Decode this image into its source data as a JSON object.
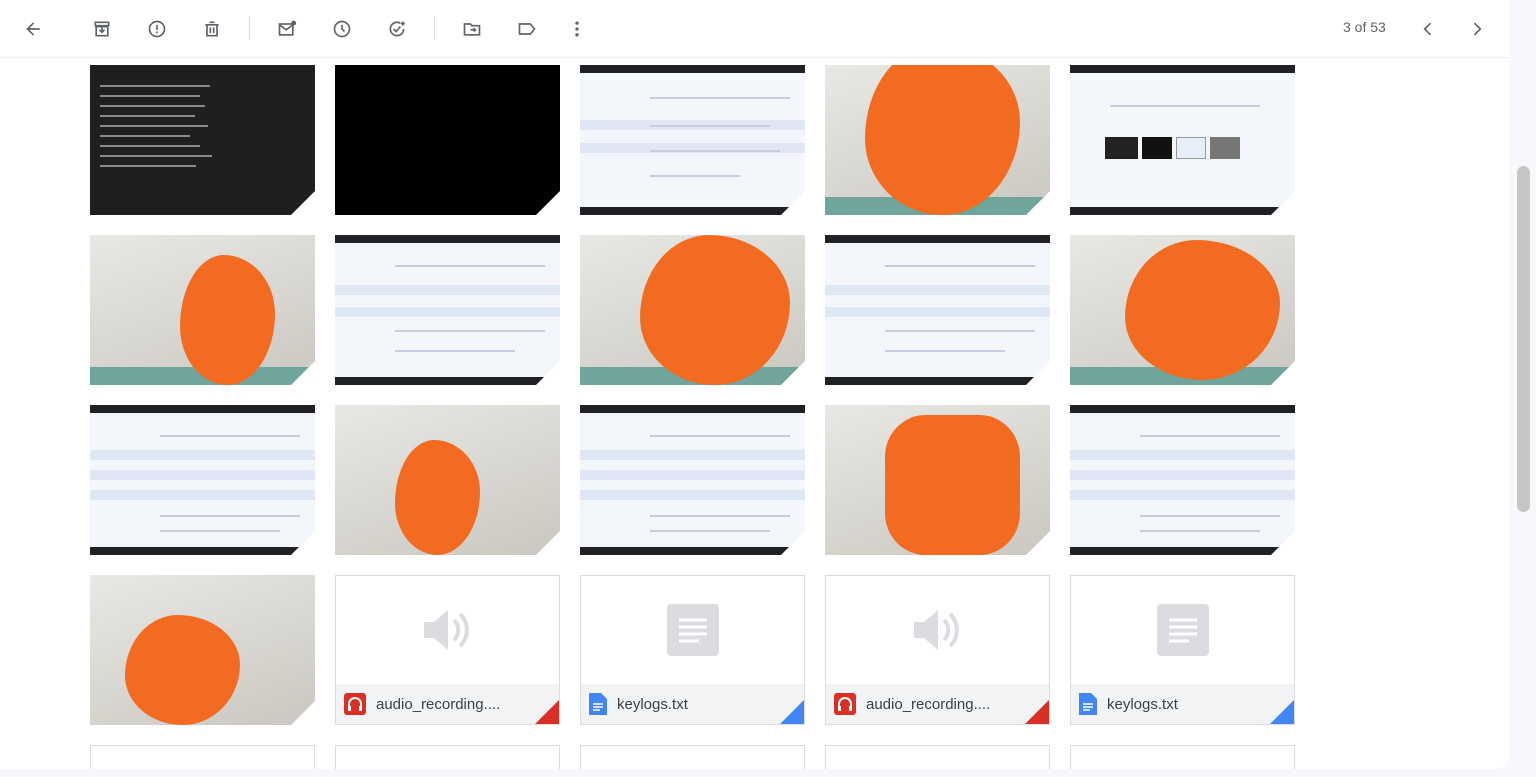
{
  "toolbar": {
    "buttons": [
      {
        "name": "back-button",
        "icon": "arrow-left-icon"
      },
      {
        "name": "archive-button",
        "icon": "archive-icon"
      },
      {
        "name": "report-spam-button",
        "icon": "report-icon"
      },
      {
        "name": "delete-button",
        "icon": "trash-icon"
      },
      {
        "name": "mark-unread-button",
        "icon": "mail-unread-icon"
      },
      {
        "name": "snooze-button",
        "icon": "clock-icon"
      },
      {
        "name": "add-task-button",
        "icon": "add-task-icon"
      },
      {
        "name": "move-to-button",
        "icon": "folder-move-icon"
      },
      {
        "name": "label-button",
        "icon": "label-icon"
      },
      {
        "name": "more-button",
        "icon": "more-vert-icon"
      }
    ],
    "pager_text": "3 of 53"
  },
  "attachments": [
    {
      "kind": "dark-screenshot"
    },
    {
      "kind": "black"
    },
    {
      "kind": "screenshot"
    },
    {
      "kind": "photo"
    },
    {
      "kind": "screenshot"
    },
    {
      "kind": "photo"
    },
    {
      "kind": "screenshot"
    },
    {
      "kind": "photo"
    },
    {
      "kind": "screenshot"
    },
    {
      "kind": "photo"
    },
    {
      "kind": "screenshot"
    },
    {
      "kind": "photo"
    },
    {
      "kind": "screenshot"
    },
    {
      "kind": "photo"
    },
    {
      "kind": "screenshot"
    },
    {
      "kind": "photo"
    },
    {
      "kind": "audio",
      "name": "audio_recording....",
      "icon": "headphones-icon",
      "accent": "#d93025"
    },
    {
      "kind": "text",
      "name": "keylogs.txt",
      "icon": "doc-icon",
      "accent": "#4285f4"
    },
    {
      "kind": "audio",
      "name": "audio_recording....",
      "icon": "headphones-icon",
      "accent": "#d93025"
    },
    {
      "kind": "text",
      "name": "keylogs.txt",
      "icon": "doc-icon",
      "accent": "#4285f4"
    }
  ],
  "colors": {
    "redaction": "#f26b21",
    "accent_blue": "#1a73e8"
  }
}
